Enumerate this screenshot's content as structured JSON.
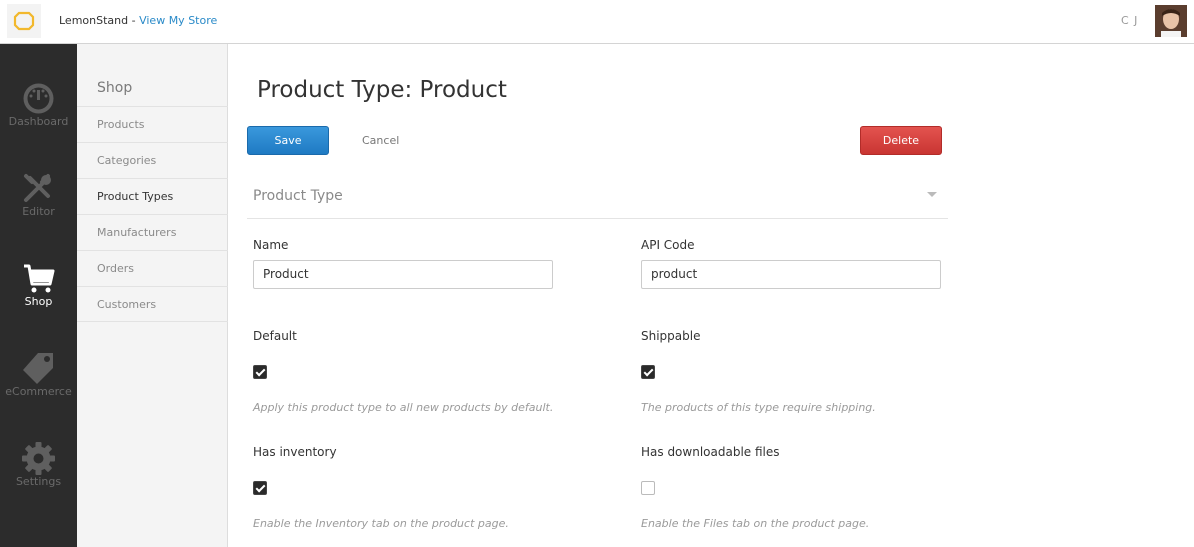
{
  "topbar": {
    "brand": "LemonStand",
    "separator": " - ",
    "store_link": "View My Store",
    "user_initials": "C J"
  },
  "sidebar": {
    "items": [
      {
        "label": "Dashboard",
        "icon": "dashboard-icon"
      },
      {
        "label": "Editor",
        "icon": "editor-icon"
      },
      {
        "label": "Shop",
        "icon": "cart-icon",
        "active": true
      },
      {
        "label": "eCommerce",
        "icon": "tag-icon"
      },
      {
        "label": "Settings",
        "icon": "gear-icon"
      }
    ]
  },
  "submenu": {
    "title": "Shop",
    "items": [
      {
        "label": "Products"
      },
      {
        "label": "Categories"
      },
      {
        "label": "Product Types",
        "active": true
      },
      {
        "label": "Manufacturers"
      },
      {
        "label": "Orders"
      },
      {
        "label": "Customers"
      }
    ]
  },
  "main": {
    "title": "Product Type: Product",
    "save_label": "Save",
    "cancel_label": "Cancel",
    "delete_label": "Delete",
    "section_title": "Product Type",
    "name_label": "Name",
    "name_value": "Product",
    "api_code_label": "API Code",
    "api_code_value": "product",
    "default_label": "Default",
    "default_checked": true,
    "default_hint": "Apply this product type to all new products by default.",
    "shippable_label": "Shippable",
    "shippable_checked": true,
    "shippable_hint": "The products of this type require shipping.",
    "inventory_label": "Has inventory",
    "inventory_checked": true,
    "inventory_hint": "Enable the Inventory tab on the product page.",
    "files_label": "Has downloadable files",
    "files_checked": false,
    "files_hint": "Enable the Files tab on the product page."
  },
  "colors": {
    "primary": "#1f7ac3",
    "danger": "#c93532",
    "sidebar_bg": "#2c2c2c",
    "link": "#2a8ac8"
  }
}
